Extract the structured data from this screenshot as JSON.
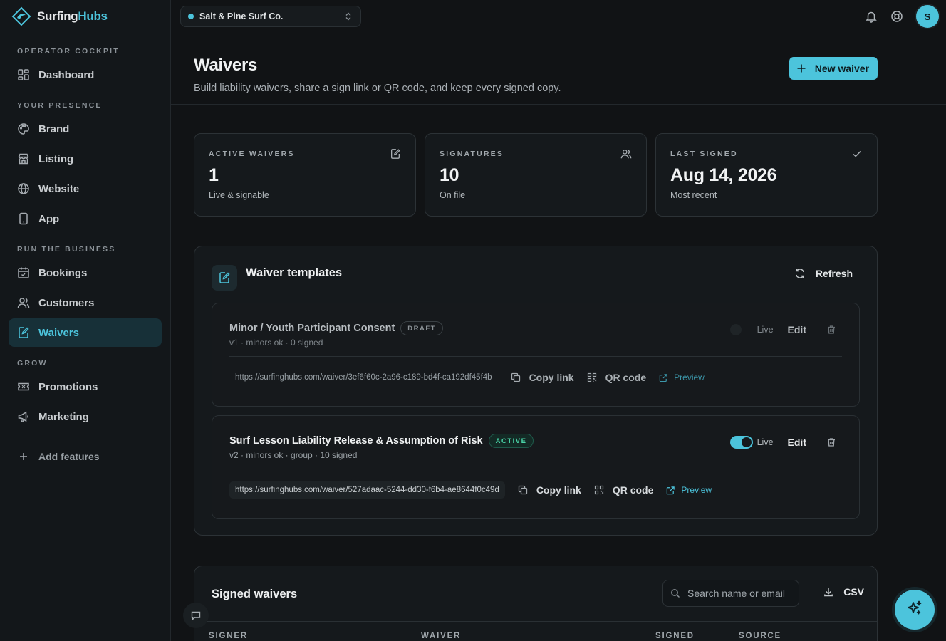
{
  "brand": {
    "name_part1": "Surfing",
    "name_part2": "Hubs"
  },
  "org_selector": {
    "value": "Salt & Pine Surf Co."
  },
  "user": {
    "initial": "S"
  },
  "sidebar": {
    "sections": [
      {
        "label": "OPERATOR COCKPIT",
        "items": [
          {
            "label": "Dashboard",
            "icon": "dashboard-icon"
          }
        ]
      },
      {
        "label": "YOUR PRESENCE",
        "items": [
          {
            "label": "Brand",
            "icon": "palette-icon"
          },
          {
            "label": "Listing",
            "icon": "store-icon"
          },
          {
            "label": "Website",
            "icon": "globe-icon"
          },
          {
            "label": "App",
            "icon": "phone-icon"
          }
        ]
      },
      {
        "label": "RUN THE BUSINESS",
        "items": [
          {
            "label": "Bookings",
            "icon": "calendar-icon"
          },
          {
            "label": "Customers",
            "icon": "users-icon"
          },
          {
            "label": "Waivers",
            "icon": "edit-doc-icon",
            "active": true
          }
        ]
      },
      {
        "label": "GROW",
        "items": [
          {
            "label": "Promotions",
            "icon": "ticket-icon"
          },
          {
            "label": "Marketing",
            "icon": "megaphone-icon"
          }
        ]
      }
    ],
    "add_features": "Add features"
  },
  "page": {
    "title": "Waivers",
    "subtitle": "Build liability waivers, share a sign link or QR code, and keep every signed copy.",
    "new_button": "New waiver"
  },
  "stats": [
    {
      "label": "ACTIVE WAIVERS",
      "value": "1",
      "note": "Live & signable",
      "icon": "edit-doc-icon"
    },
    {
      "label": "SIGNATURES",
      "value": "10",
      "note": "On file",
      "icon": "users-icon"
    },
    {
      "label": "LAST SIGNED",
      "value": "Aug 14, 2026",
      "note": "Most recent",
      "icon": "check-icon"
    }
  ],
  "templates_card": {
    "title": "Waiver templates",
    "refresh": "Refresh",
    "templates": [
      {
        "name": "Minor / Youth Participant Consent",
        "badge": "DRAFT",
        "meta": "v1 · minors ok · 0 signed",
        "live_label": "Live",
        "live": false,
        "edit": "Edit",
        "url": "https://surfinghubs.com/waiver/3ef6f60c-2a96-c189-bd4f-ca192df45f4b",
        "copy": "Copy link",
        "qr": "QR code",
        "preview": "Preview"
      },
      {
        "name": "Surf Lesson Liability Release & Assumption of Risk",
        "badge": "ACTIVE",
        "meta": "v2 · minors ok · group · 10 signed",
        "live_label": "Live",
        "live": true,
        "edit": "Edit",
        "url": "https://surfinghubs.com/waiver/527adaac-5244-dd30-f6b4-ae8644f0c49d",
        "copy": "Copy link",
        "qr": "QR code",
        "preview": "Preview"
      }
    ]
  },
  "signed_card": {
    "title": "Signed waivers",
    "search_placeholder": "Search name or email",
    "csv": "CSV",
    "columns": [
      "SIGNER",
      "WAIVER",
      "SIGNED",
      "SOURCE"
    ]
  },
  "colors": {
    "accent": "#4cc4dc",
    "background": "#111315",
    "active_badge": "#4bd6a9"
  }
}
